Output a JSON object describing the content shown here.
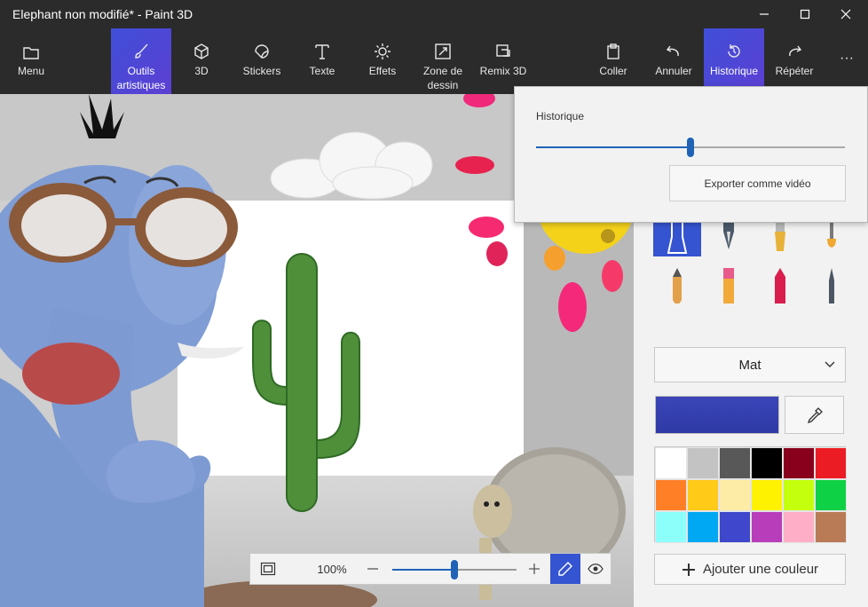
{
  "window": {
    "title": "Elephant non modifié* - Paint 3D"
  },
  "ribbon": {
    "menu": "Menu",
    "tools": [
      {
        "label": "Outils\nartistiques",
        "active": true
      },
      {
        "label": "3D"
      },
      {
        "label": "Stickers"
      },
      {
        "label": "Texte"
      },
      {
        "label": "Effets"
      },
      {
        "label": "Zone de\ndessin"
      },
      {
        "label": "Remix 3D"
      }
    ],
    "actions": {
      "paste": "Coller",
      "undo": "Annuler",
      "history": "Historique",
      "redo": "Répéter",
      "more": "···"
    }
  },
  "history_flyout": {
    "title": "Historique",
    "position": 0.5,
    "export_label": "Exporter comme vidéo"
  },
  "side_panel": {
    "finish": "Mat",
    "current_color": "#3b45b8",
    "palette": [
      "#ffffff",
      "#c3c3c3",
      "#585858",
      "#000000",
      "#88001b",
      "#ec1c24",
      "#ff7f27",
      "#ffca18",
      "#fdeca6",
      "#fff200",
      "#c4ff0e",
      "#0ed145",
      "#8cfffb",
      "#00a8f3",
      "#3f48cc",
      "#b83dba",
      "#ffaec8",
      "#b97a56"
    ],
    "add_color": "Ajouter une couleur"
  },
  "zoom_bar": {
    "zoom": "100%",
    "zoom_level": 0.5
  },
  "colors": {
    "accent": "#3554d1",
    "titlebar": "#2b2b2b"
  }
}
